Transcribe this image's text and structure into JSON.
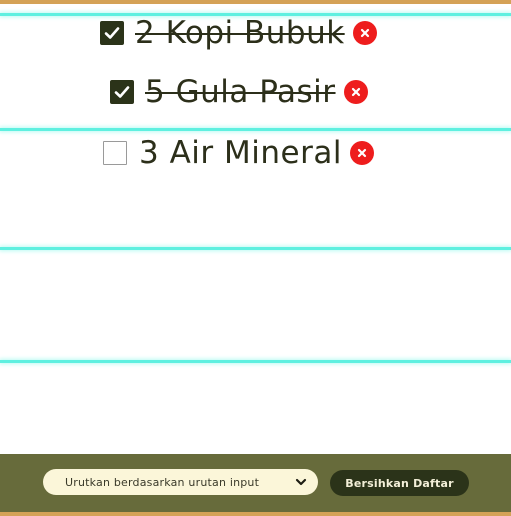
{
  "items": [
    {
      "label": "2 Kopi Bubuk",
      "checked": true
    },
    {
      "label": "5 Gula Pasir",
      "checked": true
    },
    {
      "label": "3 Air Mineral",
      "checked": false
    }
  ],
  "footer": {
    "sort_selected": "Urutkan berdasarkan urutan input",
    "clear_label": "Bersihkan Daftar"
  },
  "colors": {
    "accent_top": "#d4a257",
    "footer_bg": "#676b3b",
    "dark": "#2b3319",
    "delete": "#ee1d1d",
    "rule": "#5ef0e0"
  },
  "icons": {
    "checked": "checkmark-icon",
    "delete": "close-icon",
    "select": "chevron-down-icon"
  }
}
